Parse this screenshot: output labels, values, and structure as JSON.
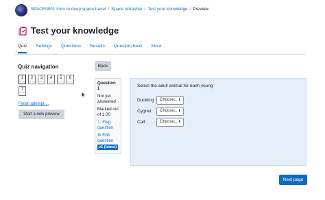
{
  "breadcrumb": {
    "items": [
      "SPACE0001 Intro to deep space travel",
      "Space refresher",
      "Test your knowledge"
    ],
    "current": "Preview"
  },
  "page": {
    "title": "Test your knowledge"
  },
  "tabs": [
    {
      "label": "Quiz",
      "active": true
    },
    {
      "label": "Settings"
    },
    {
      "label": "Questions"
    },
    {
      "label": "Results"
    },
    {
      "label": "Question bank"
    },
    {
      "label": "More"
    }
  ],
  "quiz_nav": {
    "heading": "Quiz navigation",
    "questions": [
      "1",
      "2",
      "3",
      "4",
      "5",
      "6",
      "7"
    ],
    "current_question": "1",
    "finish_link": "Finish attempt ...",
    "new_preview_button": "Start a new preview"
  },
  "back_button": "Back",
  "question_info": {
    "title": "Question 1",
    "status_line1": "Not yet",
    "status_line2": "answered",
    "marked_line1": "Marked out",
    "marked_line2": "of 1.00",
    "flag_line1": "Flag",
    "flag_line2": "question",
    "edit_line1": "Edit",
    "edit_line2": "question",
    "version_badge": "v1 (latest)"
  },
  "question": {
    "text": "Select the adult animal for each young",
    "rows": [
      {
        "label": "Duckling",
        "selected": "Choose..."
      },
      {
        "label": "Cygnet",
        "selected": "Choose..."
      },
      {
        "label": "Calf",
        "selected": "Choose..."
      }
    ]
  },
  "next_button": "Next page",
  "colors": {
    "primary": "#0f6cbf",
    "content_bg": "#e6eef9",
    "secondary_btn": "#ced4da"
  }
}
